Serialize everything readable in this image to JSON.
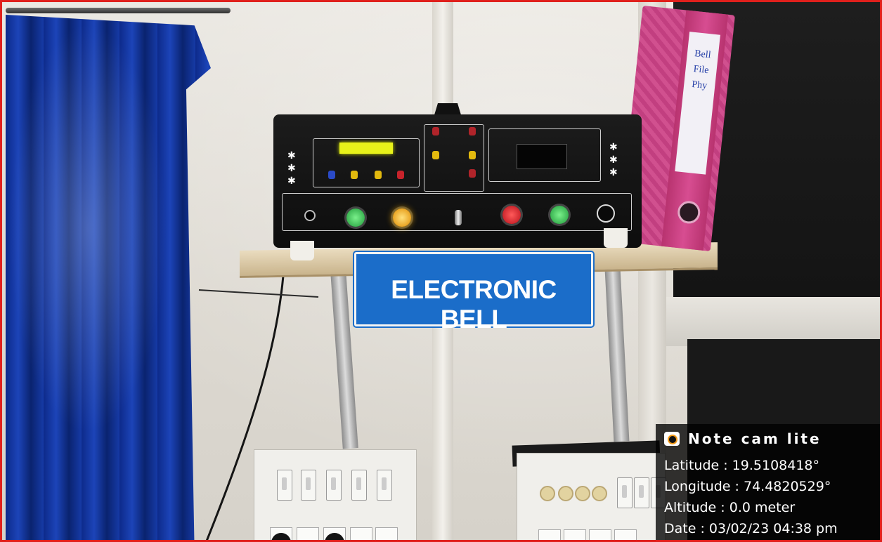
{
  "image": {
    "frame_color": "#e0201c"
  },
  "sign": {
    "text": "ELECTRONIC BELL",
    "background_color": "#1b6dc9"
  },
  "binder": {
    "label_lines": [
      "Bell",
      "File",
      "Phy"
    ]
  },
  "overlay": {
    "app_name": "Note cam lite",
    "latitude": "Latitude : 19.5108418°",
    "longitude": "Longitude : 74.4820529°",
    "altitude": "Altitude : 0.0 meter",
    "date": "Date : 03/02/23 04:38 pm",
    "icon": "camera-icon"
  }
}
